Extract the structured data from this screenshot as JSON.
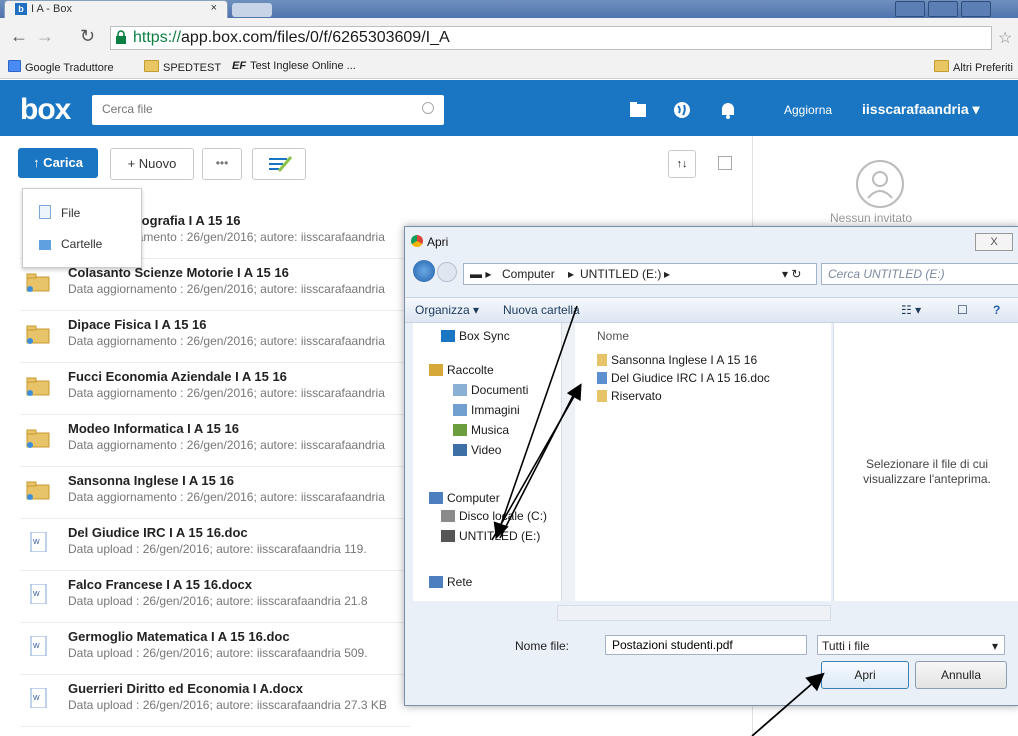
{
  "browser": {
    "tab_title": "I A - Box",
    "tab_close": "×",
    "url_scheme": "https://",
    "url_rest": "app.box.com/files/0/f/6265303609/I_A",
    "bookmarks": [
      "Google Traduttore",
      "SPEDTEST",
      "Test Inglese Online ..."
    ],
    "bookmark_other": "Altri Preferiti"
  },
  "box": {
    "logo": "box",
    "search_placeholder": "Cerca file",
    "upgrade": "Aggiorna",
    "user": "iisscarafaandria",
    "upload_label": "↑ Carica",
    "new_label": "+ Nuovo",
    "more_label": "•••",
    "sort_label": "↑↓",
    "no_invited": "Nessun invitato",
    "upload_menu": [
      "File",
      "Cartelle"
    ]
  },
  "files": [
    {
      "name": "Cocozza Geografia I A 15 16",
      "meta": "Data aggiornamento : 26/gen/2016; autore: iisscarafaandria",
      "type": "folder"
    },
    {
      "name": "Colasanto Scienze Motorie I A 15 16",
      "meta": "Data aggiornamento : 26/gen/2016; autore: iisscarafaandria",
      "type": "folder"
    },
    {
      "name": "Dipace Fisica I A 15 16",
      "meta": "Data aggiornamento : 26/gen/2016; autore: iisscarafaandria",
      "type": "folder"
    },
    {
      "name": "Fucci Economia Aziendale I A 15 16",
      "meta": "Data aggiornamento : 26/gen/2016; autore: iisscarafaandria",
      "type": "folder"
    },
    {
      "name": "Modeo Informatica I A 15 16",
      "meta": "Data aggiornamento : 26/gen/2016; autore: iisscarafaandria",
      "type": "folder"
    },
    {
      "name": "Sansonna Inglese I A 15 16",
      "meta": "Data aggiornamento : 26/gen/2016; autore: iisscarafaandria",
      "type": "folder"
    },
    {
      "name": "Del Giudice IRC I A 15 16.doc",
      "meta": "Data upload : 26/gen/2016; autore: iisscarafaandria   119.",
      "type": "doc"
    },
    {
      "name": "Falco Francese I A 15 16.docx",
      "meta": "Data upload : 26/gen/2016; autore: iisscarafaandria   21.8",
      "type": "doc"
    },
    {
      "name": "Germoglio Matematica I A 15 16.doc",
      "meta": "Data upload : 26/gen/2016; autore: iisscarafaandria   509.",
      "type": "doc"
    },
    {
      "name": "Guerrieri Diritto ed Economia I A.docx",
      "meta": "Data upload : 26/gen/2016; autore: iisscarafaandria   27.3 KB",
      "type": "doc"
    }
  ],
  "dialog": {
    "title": "Apri",
    "close": "X",
    "path": [
      "Computer",
      "UNTITLED (E:)"
    ],
    "search_placeholder": "Cerca UNTITLED (E:)",
    "organize": "Organizza ▾",
    "new_folder": "Nuova cartella",
    "nav_items": [
      "Box Sync",
      "Raccolte",
      "Documenti",
      "Immagini",
      "Musica",
      "Video",
      "Computer",
      "Disco locale (C:)",
      "UNTITLED (E:)",
      "Rete"
    ],
    "column_name": "Nome",
    "files": [
      "Sansonna Inglese I A 15 16",
      "Del Giudice IRC I A 15 16.doc",
      "Riservato"
    ],
    "preview_text": "Selezionare il file di cui visualizzare l'anteprima.",
    "filename_label": "Nome file:",
    "filename_value": "Postazioni studenti.pdf",
    "filetype": "Tutti i file",
    "open": "Apri",
    "cancel": "Annulla"
  },
  "colors": {
    "box_blue": "#1a76c2",
    "arrow": "#000000"
  }
}
